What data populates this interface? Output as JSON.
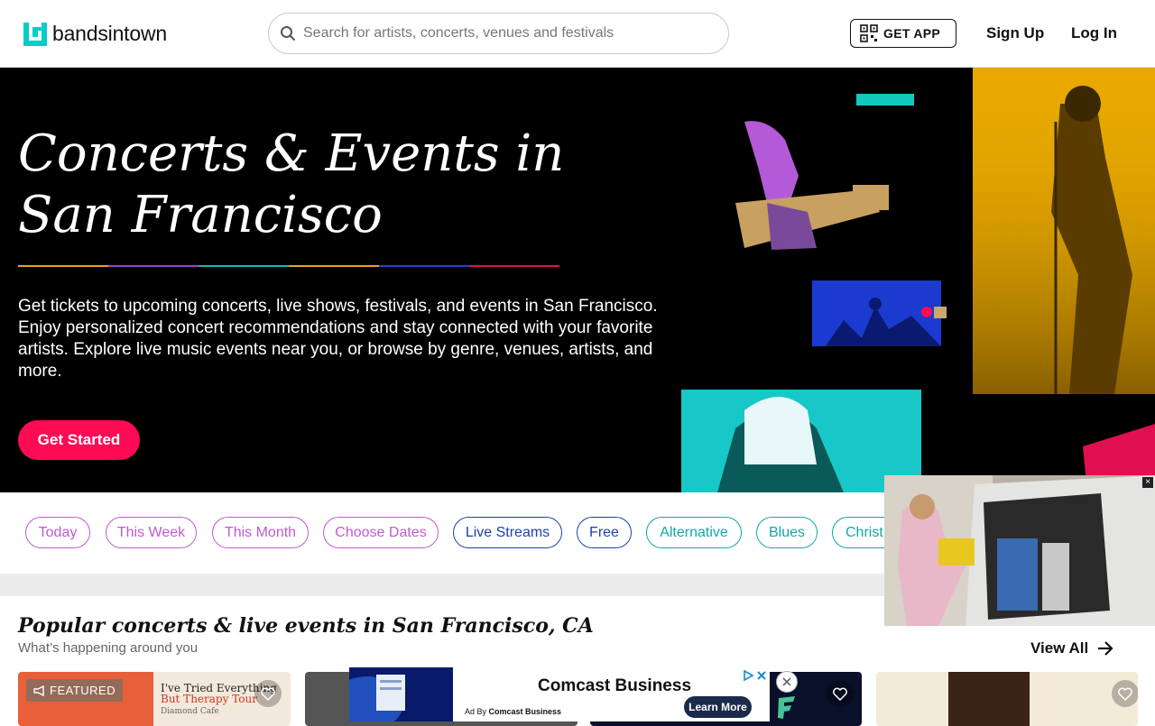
{
  "header": {
    "logo_text": "bandsintown",
    "search_placeholder": "Search for artists, concerts, venues and festivals",
    "get_app": "GET APP",
    "sign_up": "Sign Up",
    "log_in": "Log In"
  },
  "hero": {
    "title": "Concerts & Events in San Francisco",
    "description": "Get tickets to upcoming concerts, live shows, festivals, and events in San Francisco. Enjoy personalized concert recommendations and stay connected with your favorite artists. Explore live music events near you, or browse by genre, venues, artists, and more.",
    "cta": "Get Started",
    "rainbow_colors": [
      "#f0a020",
      "#9b3fd8",
      "#14b8b8",
      "#f0a020",
      "#2840c8",
      "#e01050"
    ]
  },
  "filters": [
    {
      "label": "Today",
      "color": "#c05ad0"
    },
    {
      "label": "This Week",
      "color": "#c05ad0"
    },
    {
      "label": "This Month",
      "color": "#c05ad0"
    },
    {
      "label": "Choose Dates",
      "color": "#c05ad0"
    },
    {
      "label": "Live Streams",
      "color": "#1e40b0"
    },
    {
      "label": "Free",
      "color": "#1e40b0"
    },
    {
      "label": "Alternative",
      "color": "#12a8a8"
    },
    {
      "label": "Blues",
      "color": "#12a8a8"
    },
    {
      "label": "Christ",
      "color": "#12a8a8"
    }
  ],
  "popular": {
    "title": "Popular concerts & live events in San Francisco, CA",
    "subtitle": "What’s happening around you",
    "view_all": "View All",
    "featured_label": "FEATURED",
    "card1_line1": "I've Tried Everything",
    "card1_line2": "But Therapy Tour",
    "card1_line3": "Diamond Cafe"
  },
  "ad": {
    "title": "Comcast Business",
    "by_prefix": "Ad By",
    "by_name": "Comcast Business",
    "learn_more": "Learn More"
  }
}
